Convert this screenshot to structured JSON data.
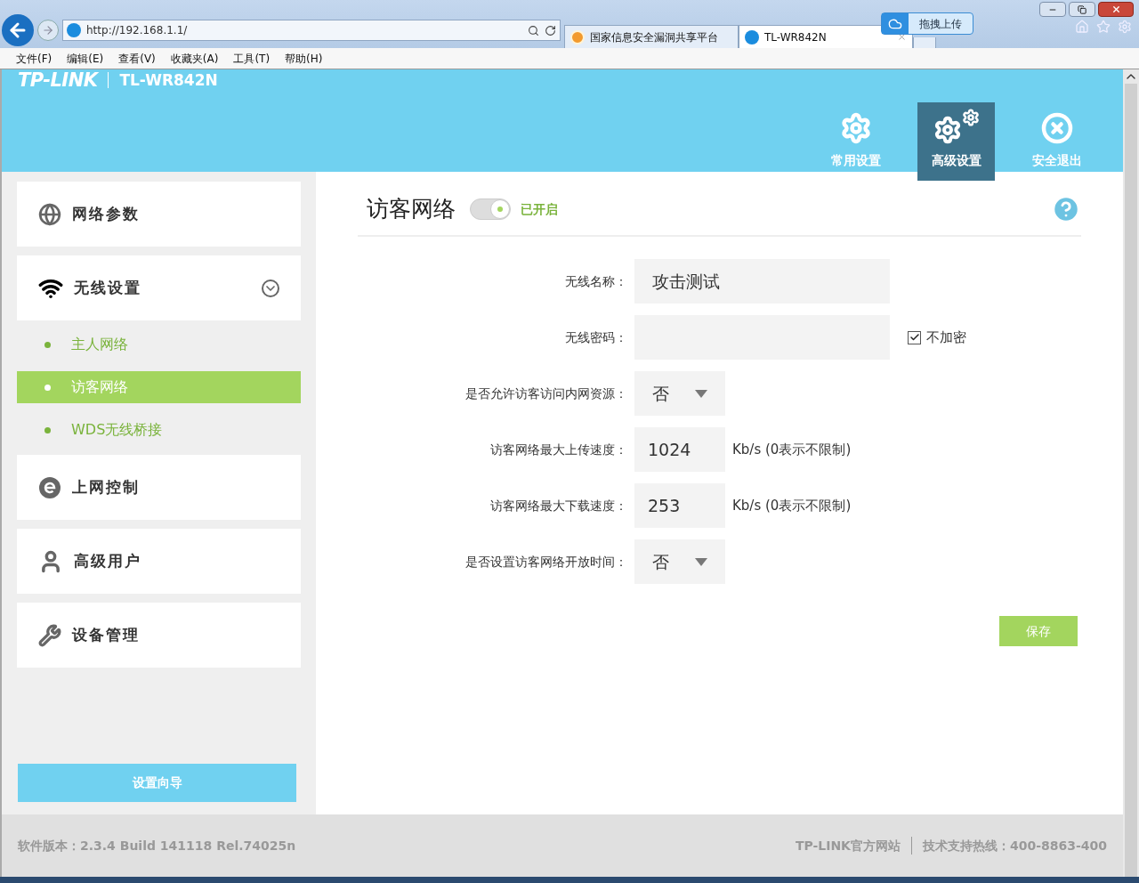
{
  "browser": {
    "address": "http://192.168.1.1/",
    "tabs": [
      {
        "title": "国家信息安全漏洞共享平台",
        "kind": "shield",
        "selected": false
      },
      {
        "title": "TL-WR842N",
        "kind": "tp",
        "selected": true
      }
    ],
    "upload_button": "拖拽上传",
    "menu": [
      "文件(F)",
      "编辑(E)",
      "查看(V)",
      "收藏夹(A)",
      "工具(T)",
      "帮助(H)"
    ]
  },
  "header": {
    "logo": "TP-LINK",
    "model": "TL-WR842N",
    "nav": [
      {
        "label": "常用设置",
        "kind": "gear",
        "selected": false
      },
      {
        "label": "高级设置",
        "kind": "gears",
        "selected": true
      },
      {
        "label": "安全退出",
        "kind": "exit",
        "selected": false
      }
    ]
  },
  "sidebar": {
    "items": [
      {
        "label": "网络参数",
        "kind": "globe"
      },
      {
        "label": "无线设置",
        "kind": "wifi",
        "expanded": true,
        "children": [
          {
            "label": "主人网络",
            "selected": false
          },
          {
            "label": "访客网络",
            "selected": true
          },
          {
            "label": "WDS无线桥接",
            "selected": false
          }
        ]
      },
      {
        "label": "上网控制",
        "kind": "web"
      },
      {
        "label": "高级用户",
        "kind": "user"
      },
      {
        "label": "设备管理",
        "kind": "tools"
      }
    ],
    "wizard_button": "设置向导"
  },
  "content": {
    "title": "访客网络",
    "toggle": {
      "on": true,
      "label": "已开启"
    },
    "fields": [
      {
        "kind": "text",
        "label": "无线名称：",
        "value": "攻击测试"
      },
      {
        "kind": "password",
        "label": "无线密码：",
        "checkbox": {
          "label": "不加密",
          "checked": true
        }
      },
      {
        "kind": "select",
        "label": "是否允许访客访问内网资源：",
        "value": "否"
      },
      {
        "kind": "number",
        "label": "访客网络最大上传速度：",
        "value": "1024",
        "unit": "Kb/s (0表示不限制)"
      },
      {
        "kind": "number",
        "label": "访客网络最大下载速度：",
        "value": "253",
        "unit": "Kb/s (0表示不限制)"
      },
      {
        "kind": "select",
        "label": "是否设置访客网络开放时间：",
        "value": "否"
      }
    ],
    "save_button": "保存"
  },
  "footer": {
    "version": "软件版本：2.3.4 Build 141118 Rel.74025n",
    "links": [
      "TP-LINK官方网站",
      "技术支持热线：400-8863-400"
    ]
  }
}
